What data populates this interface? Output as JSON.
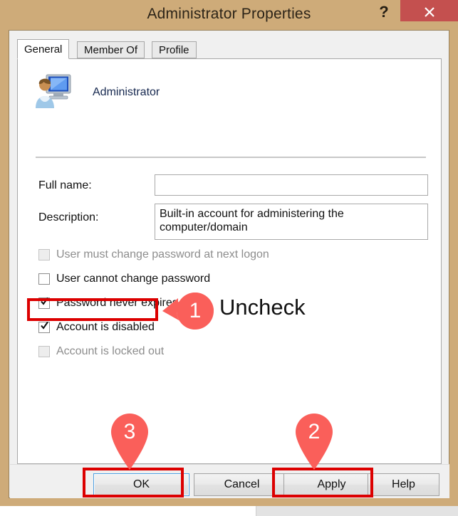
{
  "window": {
    "title": "Administrator Properties",
    "help_icon": "question-mark-icon",
    "close_icon": "close-icon",
    "frame_color": "#ceab79",
    "close_button_color": "#c4504f"
  },
  "tabs": [
    {
      "label": "General",
      "active": true
    },
    {
      "label": "Member Of",
      "active": false
    },
    {
      "label": "Profile",
      "active": false
    }
  ],
  "account": {
    "icon": "user-computer-icon",
    "name": "Administrator"
  },
  "fields": [
    {
      "label": "Full name:",
      "value": "",
      "placeholder": ""
    },
    {
      "label": "Description:",
      "value": "Built-in account for administering the computer/domain",
      "placeholder": ""
    }
  ],
  "checkboxes": [
    {
      "label": "User must change password at next logon",
      "checked": false,
      "disabled": true
    },
    {
      "label": "User cannot change password",
      "checked": false,
      "disabled": false
    },
    {
      "label": "Password never expires",
      "checked": true,
      "disabled": false
    },
    {
      "label": "Account is disabled",
      "checked": true,
      "disabled": false
    },
    {
      "label": "Account is locked out",
      "checked": false,
      "disabled": true
    }
  ],
  "buttons": [
    {
      "label": "OK",
      "default": true
    },
    {
      "label": "Cancel",
      "default": false
    },
    {
      "label": "Apply",
      "default": false
    },
    {
      "label": "Help",
      "default": false
    }
  ],
  "annotations": {
    "accent_color": "#fa5f5a",
    "highlight_color": "#dc0000",
    "step1": {
      "number": "1",
      "text": "Uncheck"
    },
    "step2": {
      "number": "2",
      "text": ""
    },
    "step3": {
      "number": "3",
      "text": ""
    }
  }
}
